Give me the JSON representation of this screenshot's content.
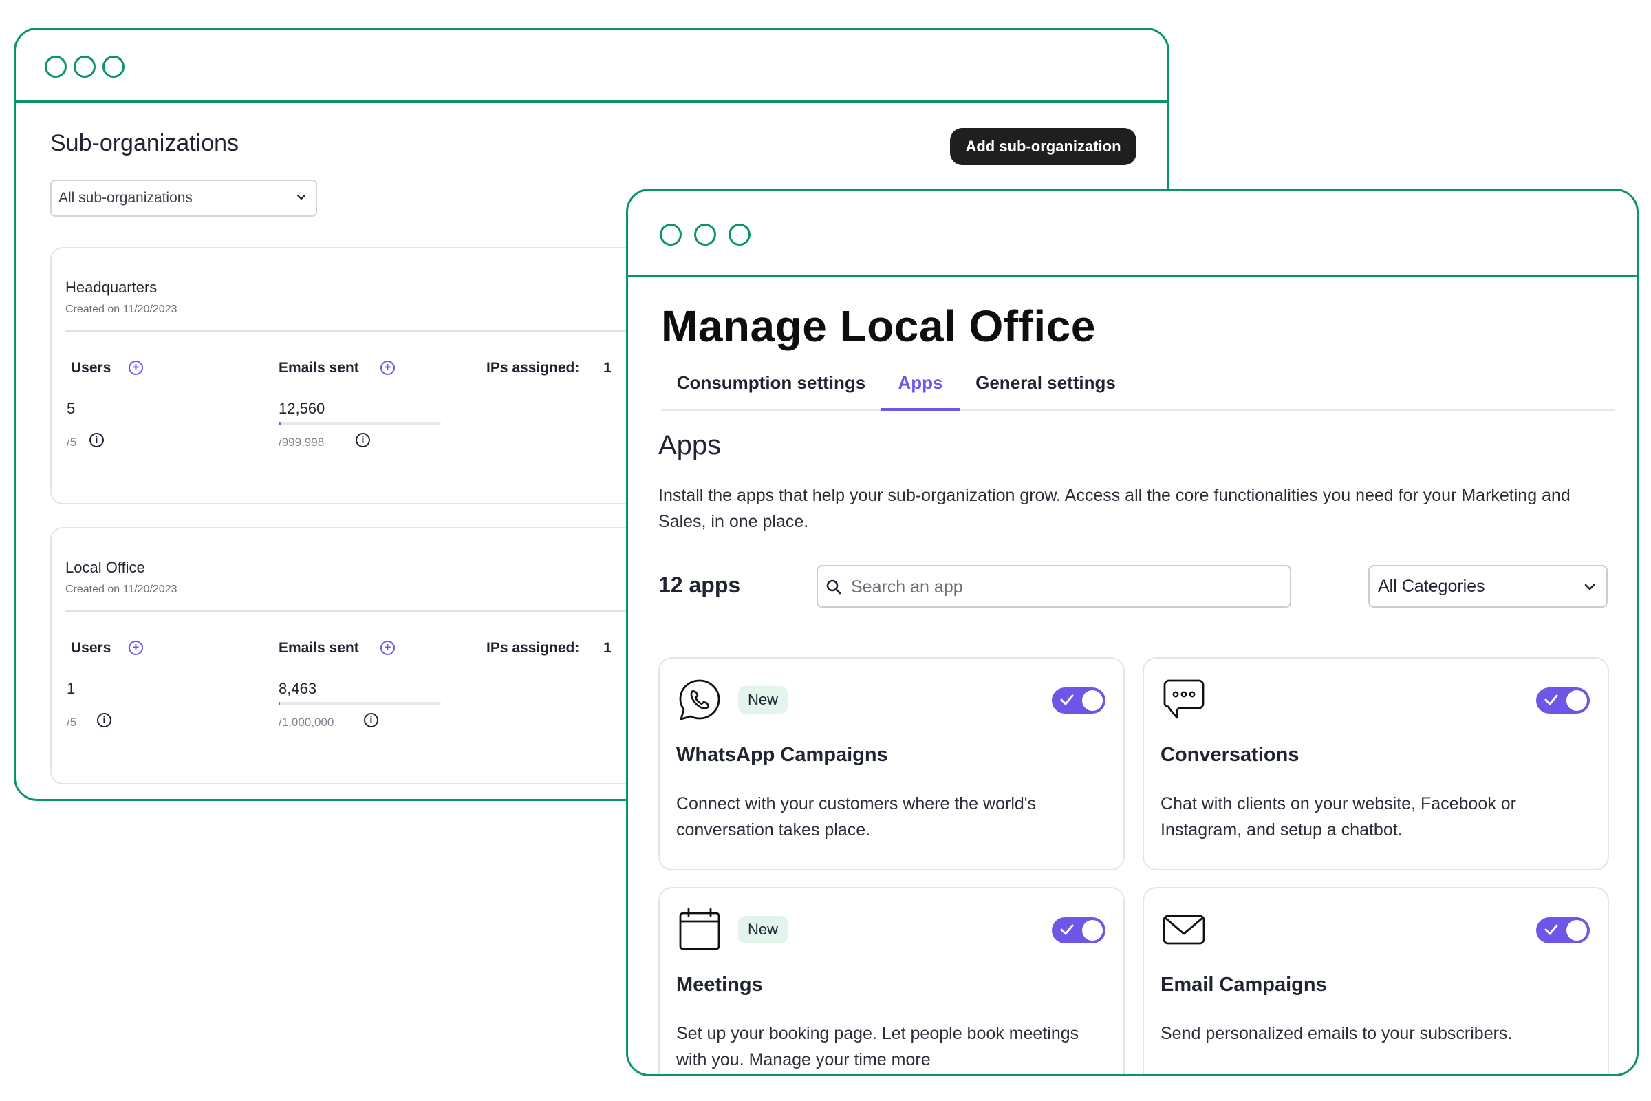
{
  "suborgs": {
    "title": "Sub-organizations",
    "add_button": "Add sub-organization",
    "filter": {
      "selected": "All sub-organizations"
    },
    "labels": {
      "users": "Users",
      "emails_sent": "Emails sent",
      "ips_assigned": "IPs assigned:"
    },
    "cards": [
      {
        "name": "Headquarters",
        "created": "Created on 11/20/2023",
        "users": "5",
        "users_limit": "/5",
        "emails": "12,560",
        "emails_limit": "/999,998",
        "emails_progress": 0.0126,
        "ips": "1"
      },
      {
        "name": "Local Office",
        "created": "Created on 11/20/2023",
        "users": "1",
        "users_limit": "/5",
        "emails": "8,463",
        "emails_limit": "/1,000,000",
        "emails_progress": 0.0085,
        "ips": "1"
      }
    ]
  },
  "manage": {
    "title": "Manage Local Office",
    "tabs": [
      {
        "label": "Consumption settings",
        "active": false
      },
      {
        "label": "Apps",
        "active": true
      },
      {
        "label": "General settings",
        "active": false
      }
    ],
    "section_title": "Apps",
    "section_desc": "Install the apps that help your sub-organization grow. Access all the core functionalities you need for your Marketing and Sales, in one place.",
    "app_count": "12 apps",
    "search": {
      "placeholder": "Search an app",
      "value": ""
    },
    "category": {
      "selected": "All Categories"
    },
    "apps": [
      {
        "icon": "whatsapp-icon",
        "badge": "New",
        "name": "WhatsApp Campaigns",
        "desc": "Connect with your customers where the world's conversation takes place.",
        "enabled": true
      },
      {
        "icon": "chat-bubble-icon",
        "badge": "",
        "name": "Conversations",
        "desc": "Chat with clients on your website, Facebook or Instagram, and setup a chatbot.",
        "enabled": true
      },
      {
        "icon": "calendar-icon",
        "badge": "New",
        "name": "Meetings",
        "desc": "Set up your booking page. Let people book meetings with you. Manage your time more",
        "enabled": true
      },
      {
        "icon": "envelope-icon",
        "badge": "",
        "name": "Email Campaigns",
        "desc": "Send personalized emails to your subscribers.",
        "enabled": true
      }
    ]
  },
  "colors": {
    "frame": "#0b9466",
    "accent": "#6e56e8",
    "badge_bg": "#e3f4ec",
    "button_dark": "#1f1f1f"
  }
}
